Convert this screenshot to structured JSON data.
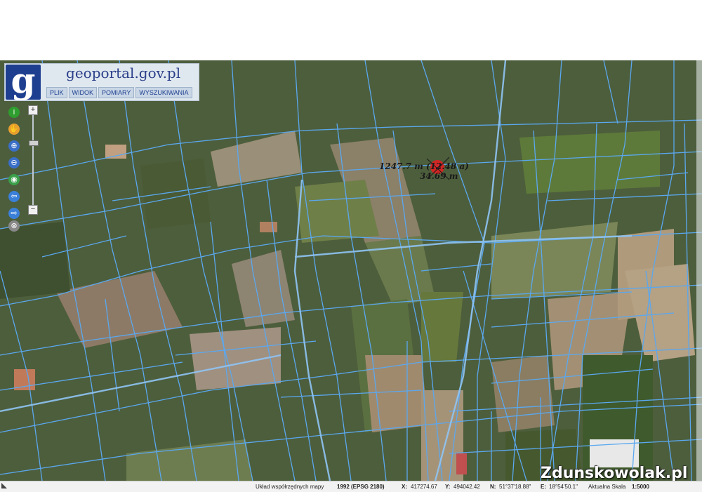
{
  "site": {
    "title_prefix": "g",
    "title_rest": "eoportal.gov.pl",
    "logo_letter": "g"
  },
  "menu": [
    {
      "label": "PLIK"
    },
    {
      "label": "WIDOK"
    },
    {
      "label": "POMIARY"
    },
    {
      "label": "WYSZUKIWANIA"
    }
  ],
  "tools": [
    {
      "icon": "info-icon",
      "glyph": "i",
      "color": "#2e9e2e"
    },
    {
      "icon": "pan-hand-icon",
      "glyph": "✋",
      "color": "#e8a030"
    },
    {
      "icon": "zoom-in-icon",
      "glyph": "⊕",
      "color": "#3a6fc8"
    },
    {
      "icon": "zoom-out-icon",
      "glyph": "⊖",
      "color": "#3a6fc8"
    },
    {
      "icon": "globe-icon",
      "glyph": "◉",
      "color": "#3aa04a"
    },
    {
      "icon": "arrow-left-icon",
      "glyph": "⇦",
      "color": "#3a7fd8"
    },
    {
      "icon": "arrow-right-icon",
      "glyph": "⇨",
      "color": "#3a7fd8"
    },
    {
      "icon": "close-icon",
      "glyph": "⊗",
      "color": "#666666"
    }
  ],
  "zoom": {
    "plus": "+",
    "minus": "−"
  },
  "measurement": {
    "area_text": "1247.7 m",
    "area_suffix": "(12.48 a)",
    "length_text": "34.69 m"
  },
  "status": {
    "crs_label": "Układ współrzędnych mapy",
    "crs_value": "1992 (EPSG 2180)",
    "x_label": "X:",
    "x_value": "417274.67",
    "y_label": "Y:",
    "y_value": "494042.42",
    "n_label": "N:",
    "n_value": "51°37'18.88\"",
    "e_label": "E:",
    "e_value": "18°54'50.1\"",
    "scale_label": "Aktualna Skala",
    "scale_value": "1:5000"
  },
  "watermark": "Zdunskowolak.pl",
  "colors": {
    "parcel_line": "#5aa8f0",
    "logo_bg": "#1e3f8f",
    "marker": "#e02020"
  }
}
